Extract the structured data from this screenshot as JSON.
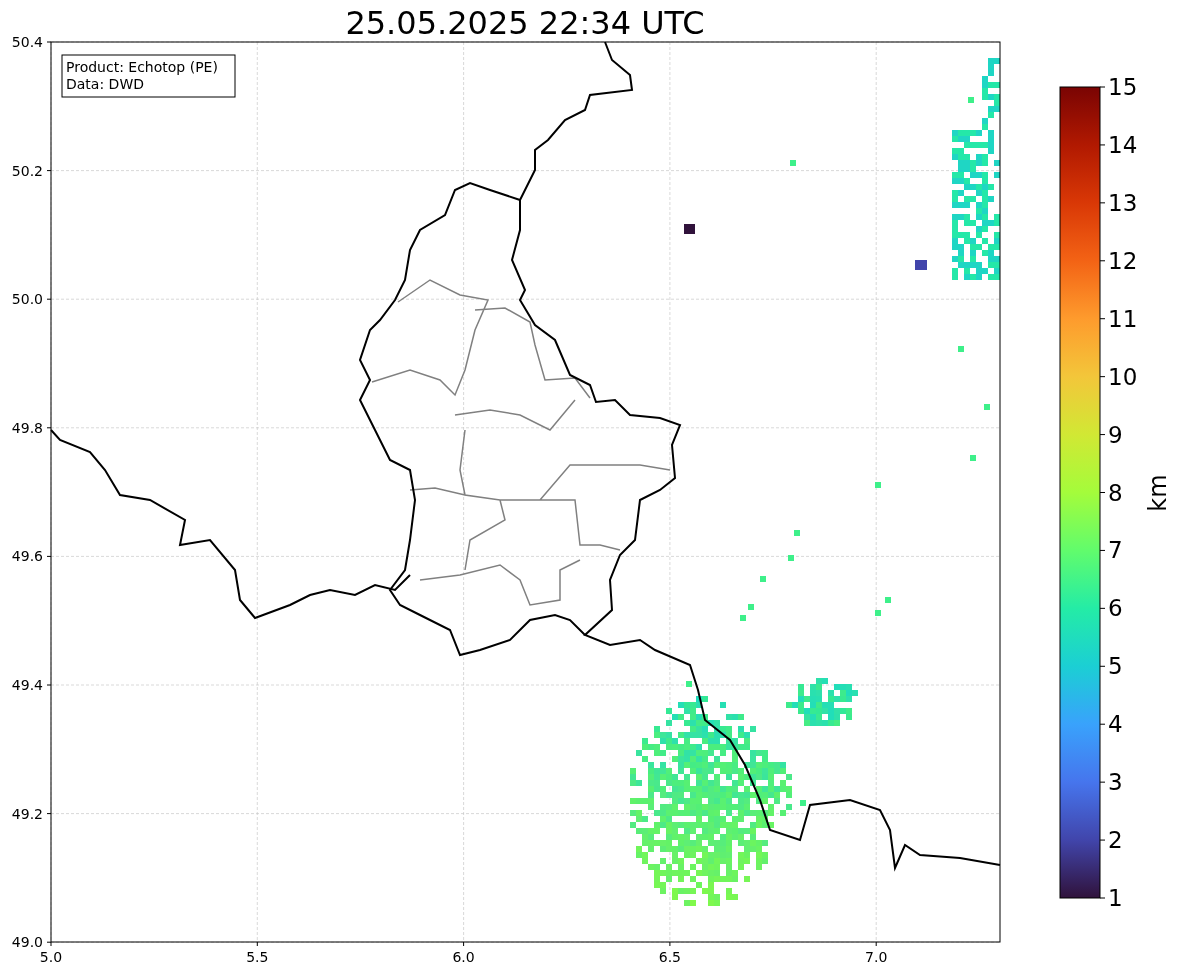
{
  "title": "25.05.2025 22:34 UTC",
  "legend": [
    "Product: Echotop (PE)",
    "Data: DWD"
  ],
  "x_ticks": [
    "5.0",
    "5.5",
    "6.0",
    "6.5",
    "7.0"
  ],
  "y_ticks": [
    "50.4",
    "50.2",
    "50.0",
    "49.8",
    "49.6",
    "49.4",
    "49.2",
    "49.0"
  ],
  "colorbar": {
    "label": "km",
    "ticks": [
      "15",
      "14",
      "13",
      "12",
      "11",
      "10",
      "9",
      "8",
      "7",
      "6",
      "5",
      "4",
      "3",
      "2",
      "1"
    ]
  }
}
